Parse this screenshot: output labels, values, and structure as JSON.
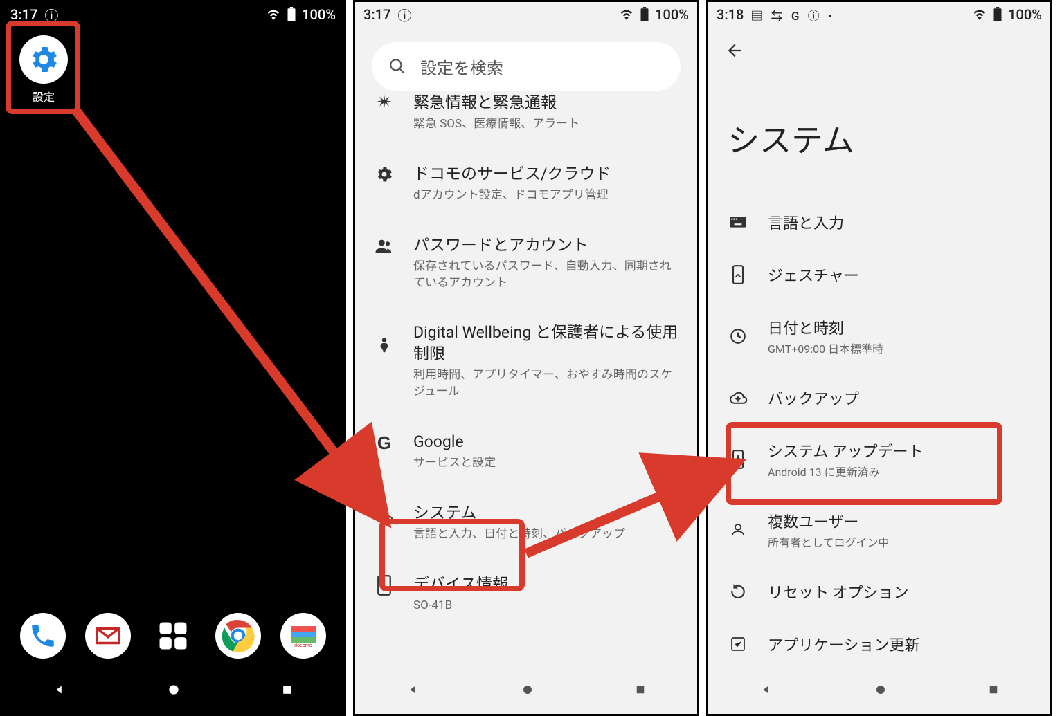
{
  "screen1": {
    "status": {
      "time": "3:17",
      "battery": "100%"
    },
    "settings_icon_label": "設定"
  },
  "screen2": {
    "status": {
      "time": "3:17",
      "battery": "100%"
    },
    "search_placeholder": "設定を検索",
    "items": [
      {
        "title": "緊急情報と緊急通報",
        "sub": "緊急 SOS、医療情報、アラート"
      },
      {
        "title": "ドコモのサービス/クラウド",
        "sub": "dアカウント設定、ドコモアプリ管理"
      },
      {
        "title": "パスワードとアカウント",
        "sub": "保存されているパスワード、自動入力、同期されているアカウント"
      },
      {
        "title": "Digital Wellbeing と保護者による使用制限",
        "sub": "利用時間、アプリタイマー、おやすみ時間のスケジュール"
      },
      {
        "title": "Google",
        "sub": "サービスと設定"
      },
      {
        "title": "システム",
        "sub": "言語と入力、日付と時刻、バックアップ"
      },
      {
        "title": "デバイス情報",
        "sub": "SO-41B"
      }
    ]
  },
  "screen3": {
    "status": {
      "time": "3:18",
      "battery": "100%"
    },
    "page_title": "システム",
    "items": [
      {
        "title": "言語と入力",
        "sub": ""
      },
      {
        "title": "ジェスチャー",
        "sub": ""
      },
      {
        "title": "日付と時刻",
        "sub": "GMT+09:00 日本標準時"
      },
      {
        "title": "バックアップ",
        "sub": ""
      },
      {
        "title": "システム アップデート",
        "sub": "Android 13 に更新済み"
      },
      {
        "title": "複数ユーザー",
        "sub": "所有者としてログイン中"
      },
      {
        "title": "リセット オプション",
        "sub": ""
      },
      {
        "title": "アプリケーション更新",
        "sub": ""
      }
    ]
  }
}
